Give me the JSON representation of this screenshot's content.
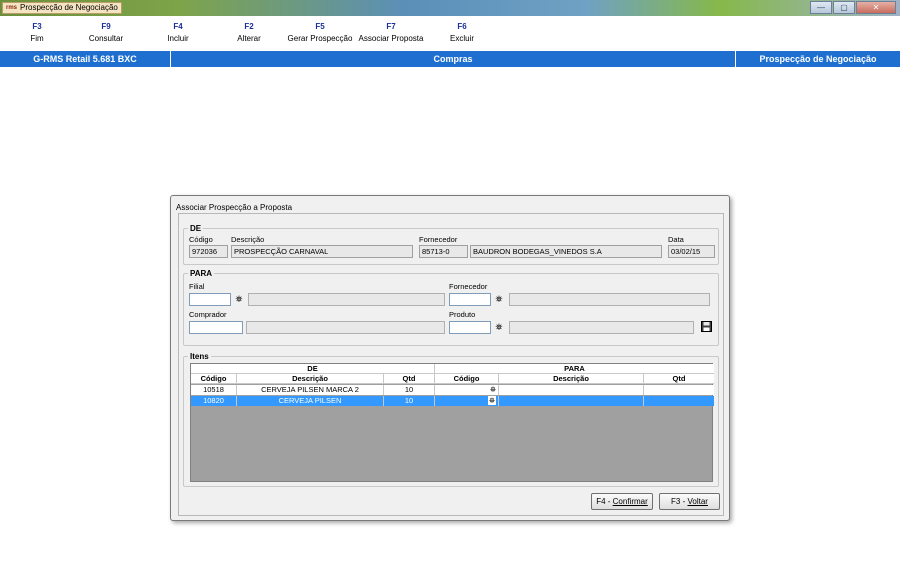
{
  "window": {
    "title": "Prospecção de Negociação",
    "controls": [
      "—",
      "▢",
      "✕"
    ]
  },
  "toolbar": {
    "keys": [
      {
        "key": "F3",
        "label": "Fim"
      },
      {
        "key": "F9",
        "label": "Consultar"
      },
      {
        "key": "F4",
        "label": "Incluir"
      },
      {
        "key": "F2",
        "label": "Alterar"
      },
      {
        "key": "F5",
        "label": "Gerar Prospecção"
      },
      {
        "key": "F7",
        "label": "Associar Proposta"
      },
      {
        "key": "F6",
        "label": "Excluir"
      }
    ]
  },
  "statusbar": {
    "version": "G-RMS Retail 5.681 BXC",
    "module": "Compras",
    "screen": "Prospecção de Negociação"
  },
  "dialog": {
    "title": "Associar Prospecção a Proposta",
    "de": {
      "legend": "DE",
      "codigo_label": "Código",
      "codigo_value": "972036",
      "descricao_label": "Descrição",
      "descricao_value": "PROSPECÇÃO CARNAVAL",
      "fornecedor_label": "Fornecedor",
      "fornecedor_code": "85713-0",
      "fornecedor_name": "BAUDRON BODEGAS_VINEDOS S.A",
      "data_label": "Data",
      "data_value": "03/02/15"
    },
    "para": {
      "legend": "PARA",
      "filial_label": "Filial",
      "fornecedor_label": "Fornecedor",
      "comprador_label": "Comprador",
      "produto_label": "Produto"
    },
    "itens": {
      "legend": "Itens",
      "group_de": "DE",
      "group_para": "PARA",
      "columns": [
        "Código",
        "Descrição",
        "Qtd",
        "Código",
        "Descrição",
        "Qtd"
      ],
      "rows": [
        {
          "codigo": "10518",
          "descricao": "CERVEJA PILSEN MARCA 2",
          "qtd": "10"
        },
        {
          "codigo": "10820",
          "descricao": "CERVEJA PILSEN",
          "qtd": "10"
        }
      ]
    },
    "buttons": {
      "confirm_key": "F4 - ",
      "confirm_label": "Confirmar",
      "back_key": "F3 - ",
      "back_label": "Voltar"
    }
  },
  "colors": {
    "statusbar": "#1e6fd0",
    "selected_row": "#3399ff",
    "fkey": "#1a2f9c"
  }
}
